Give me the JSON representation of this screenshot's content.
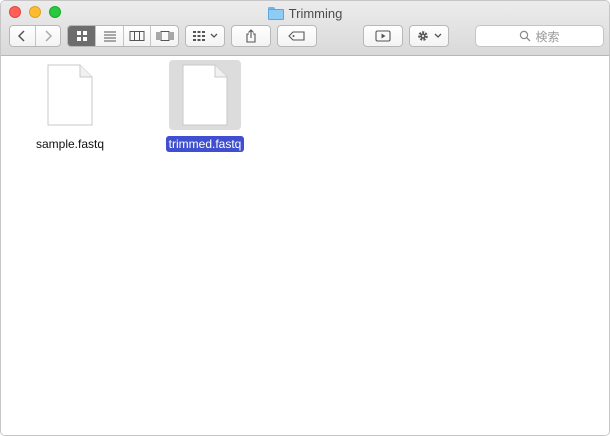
{
  "window": {
    "title": "Trimming"
  },
  "toolbar": {
    "search_placeholder": "検索"
  },
  "files": [
    {
      "name": "sample.fastq",
      "selected": false
    },
    {
      "name": "trimmed.fastq",
      "selected": true
    }
  ],
  "colors": {
    "selection": "#3f4fcf",
    "folder": "#8ecbf5",
    "close": "#ff5f57",
    "minimize": "#febc2e",
    "zoom": "#28c840"
  },
  "icons": {
    "nav_back": "chevron-left-icon",
    "nav_forward": "chevron-right-icon",
    "view_icons": "icon-grid-icon",
    "view_list": "list-icon",
    "view_columns": "columns-icon",
    "view_gallery": "gallery-icon",
    "group": "group-grid-icon",
    "share": "share-icon",
    "tag": "tag-icon",
    "quicklook": "play-icon",
    "action": "gear-icon",
    "search": "search-icon"
  }
}
